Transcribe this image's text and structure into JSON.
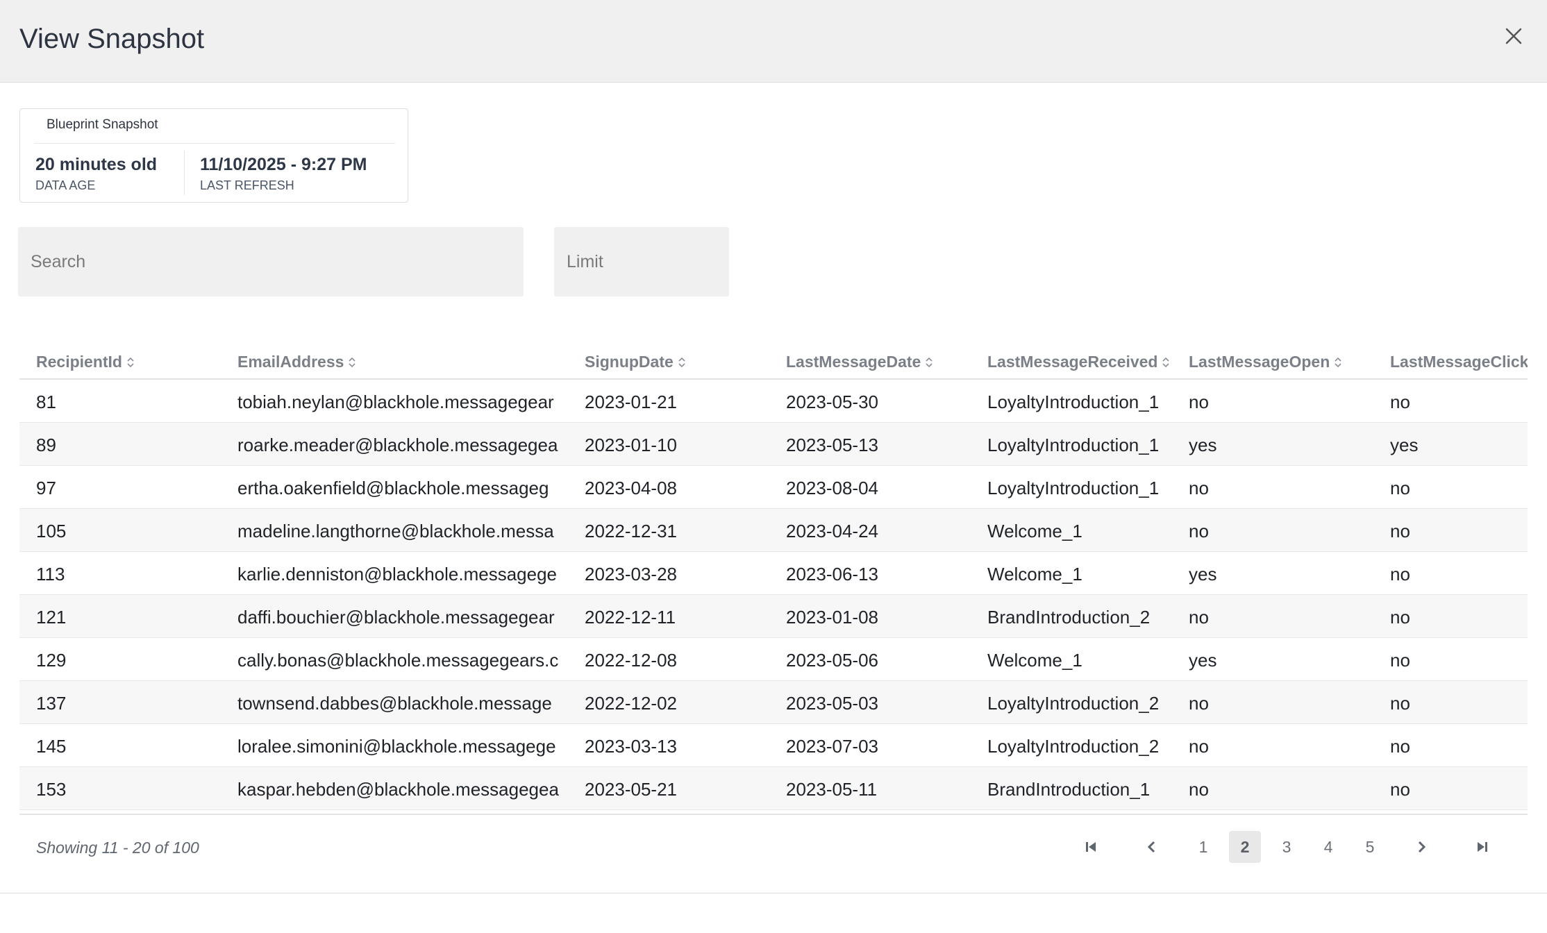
{
  "dialog": {
    "title": "View Snapshot",
    "close_icon": "close-icon"
  },
  "snapshot": {
    "card_title": "Blueprint Snapshot",
    "data_age_value": "20 minutes old",
    "data_age_label": "DATA AGE",
    "last_refresh_value": "11/10/2025 - 9:27 PM",
    "last_refresh_label": "LAST REFRESH"
  },
  "filters": {
    "search_placeholder": "Search",
    "limit_placeholder": "Limit"
  },
  "table": {
    "columns": [
      "RecipientId",
      "EmailAddress",
      "SignupDate",
      "LastMessageDate",
      "LastMessageReceived",
      "LastMessageOpen",
      "LastMessageClick"
    ],
    "rows": [
      [
        "81",
        "tobiah.neylan@blackhole.messagegear",
        "2023-01-21",
        "2023-05-30",
        "LoyaltyIntroduction_1",
        "no",
        "no"
      ],
      [
        "89",
        "roarke.meader@blackhole.messagegea",
        "2023-01-10",
        "2023-05-13",
        "LoyaltyIntroduction_1",
        "yes",
        "yes"
      ],
      [
        "97",
        "ertha.oakenfield@blackhole.messageg",
        "2023-04-08",
        "2023-08-04",
        "LoyaltyIntroduction_1",
        "no",
        "no"
      ],
      [
        "105",
        "madeline.langthorne@blackhole.messa",
        "2022-12-31",
        "2023-04-24",
        "Welcome_1",
        "no",
        "no"
      ],
      [
        "113",
        "karlie.denniston@blackhole.messagege",
        "2023-03-28",
        "2023-06-13",
        "Welcome_1",
        "yes",
        "no"
      ],
      [
        "121",
        "daffi.bouchier@blackhole.messagegear",
        "2022-12-11",
        "2023-01-08",
        "BrandIntroduction_2",
        "no",
        "no"
      ],
      [
        "129",
        "cally.bonas@blackhole.messagegears.c",
        "2022-12-08",
        "2023-05-06",
        "Welcome_1",
        "yes",
        "no"
      ],
      [
        "137",
        "townsend.dabbes@blackhole.message",
        "2022-12-02",
        "2023-05-03",
        "LoyaltyIntroduction_2",
        "no",
        "no"
      ],
      [
        "145",
        "loralee.simonini@blackhole.messagege",
        "2023-03-13",
        "2023-07-03",
        "LoyaltyIntroduction_2",
        "no",
        "no"
      ],
      [
        "153",
        "kaspar.hebden@blackhole.messagegea",
        "2023-05-21",
        "2023-05-11",
        "BrandIntroduction_1",
        "no",
        "no"
      ]
    ]
  },
  "pagination": {
    "summary": "Showing 11 - 20 of 100",
    "pages": [
      "1",
      "2",
      "3",
      "4",
      "5"
    ],
    "current_page": "2",
    "icons": [
      "first-page-icon",
      "previous-page-icon",
      "next-page-icon",
      "last-page-icon"
    ]
  }
}
